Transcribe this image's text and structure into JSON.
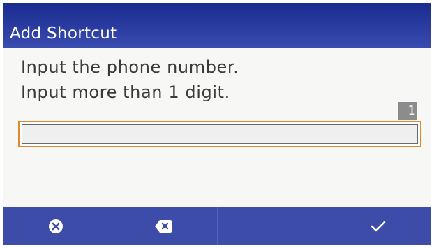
{
  "dialog": {
    "title": "Add Shortcut",
    "instruction_line1": "Input the phone number.",
    "instruction_line2": "Input more than 1 digit.",
    "digit_count": "1",
    "phone_input_value": ""
  },
  "softkeys": [
    {
      "icon": "cancel-icon"
    },
    {
      "icon": "backspace-icon"
    },
    {
      "icon": ""
    },
    {
      "icon": "checkmark-icon"
    }
  ],
  "colors": {
    "titlebar": "#1b2c8f",
    "softkey_bar": "#3d4ca8",
    "input_focus_border": "#e08a2b",
    "counter_badge": "#8c8c8c"
  }
}
